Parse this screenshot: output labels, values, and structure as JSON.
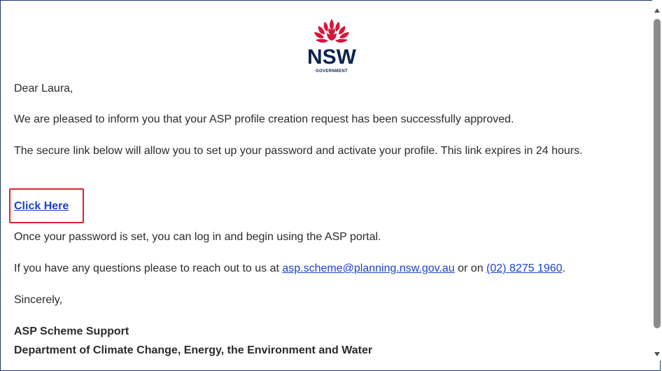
{
  "logo": {
    "word": "NSW",
    "subtitle": "GOVERNMENT",
    "icon": "waratah-icon",
    "colors": {
      "petals": "#d7153a",
      "text": "#0d2452"
    }
  },
  "email": {
    "greeting": "Dear Laura,",
    "para_approved": "We are pleased to inform you that your ASP profile creation request has been successfully approved.",
    "para_secure_link": "The secure link below will allow you to set up your password and activate your profile. This link expires in 24 hours.",
    "click_here": "Click Here",
    "para_login": "Once your password is set, you can log in and begin using the ASP portal.",
    "questions_prefix": "If you have any questions please to reach out to us at ",
    "contact_email": "asp.scheme@planning.nsw.gov.au",
    "questions_middle": " or on ",
    "contact_phone": "(02) 8275 1960",
    "questions_suffix": ".",
    "signoff": "Sincerely,",
    "signature_name": "ASP Scheme Support",
    "signature_dept": "Department of Climate Change, Energy, the Environment and Water"
  },
  "colors": {
    "link": "#1b44c8",
    "highlight_box": "#e0222a",
    "frame_border": "#1a3a6e",
    "body_text": "#2b2b2b"
  }
}
